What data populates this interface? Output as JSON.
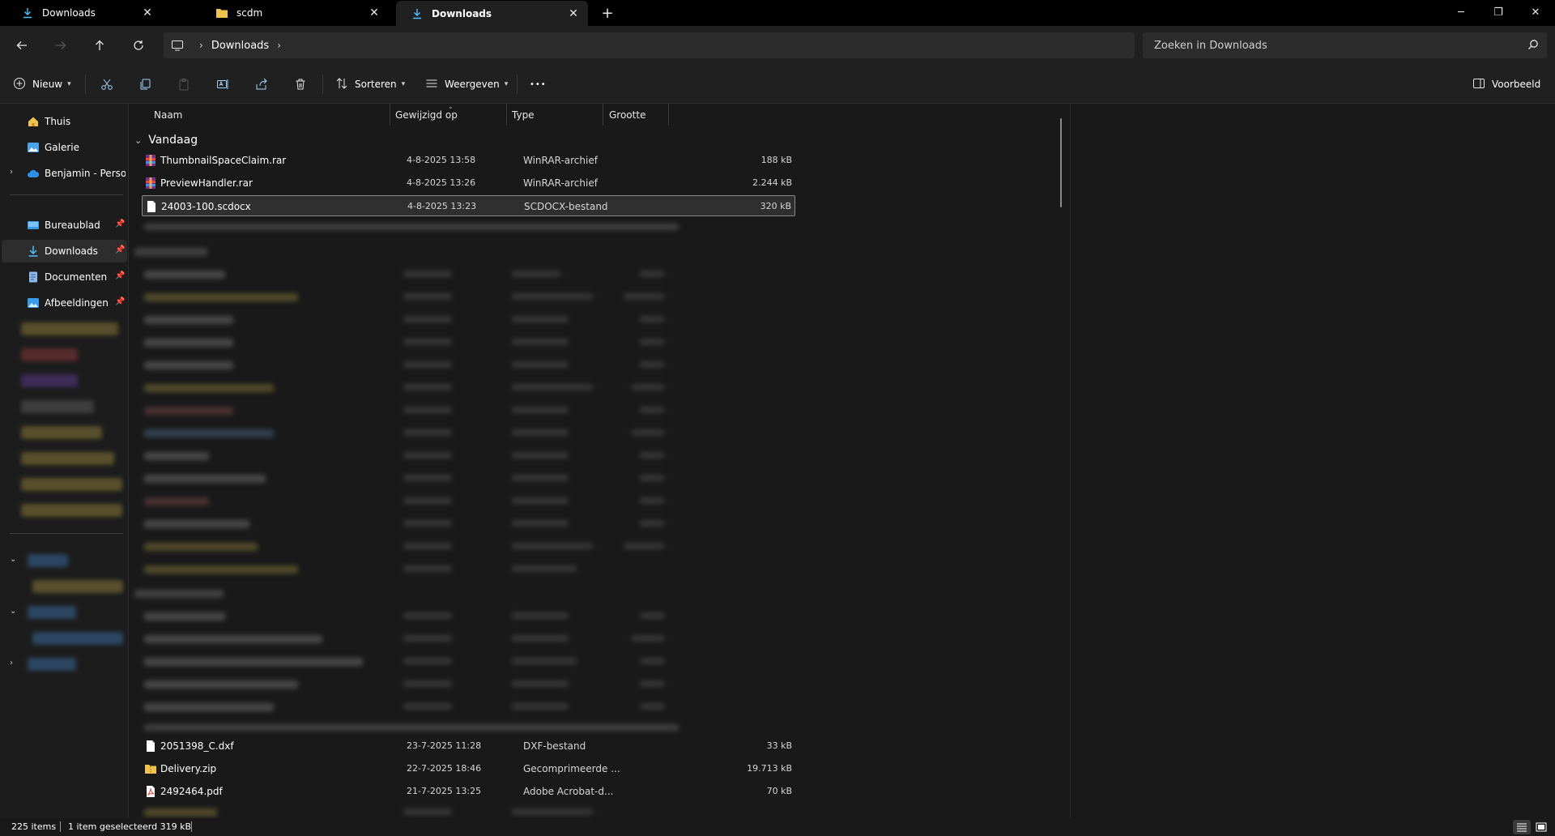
{
  "tabs": [
    {
      "label": "Downloads",
      "icon": "download-icon"
    },
    {
      "label": "scdm",
      "icon": "folder-icon"
    },
    {
      "label": "Downloads",
      "icon": "download-icon",
      "active": true
    }
  ],
  "address": {
    "crumbs": [
      "Downloads"
    ],
    "search_placeholder": "Zoeken in Downloads"
  },
  "commands": {
    "new_label": "Nieuw",
    "sort_label": "Sorteren",
    "view_label": "Weergeven",
    "more_label": "•••",
    "preview_label": "Voorbeeld"
  },
  "sidebar": {
    "top_items": [
      {
        "label": "Thuis",
        "icon": "home-icon"
      },
      {
        "label": "Galerie",
        "icon": "gallery-icon"
      },
      {
        "label": "Benjamin - Persoonlijk",
        "icon": "onedrive-icon"
      }
    ],
    "pinned": [
      {
        "label": "Bureaublad",
        "icon": "desktop-icon"
      },
      {
        "label": "Downloads",
        "icon": "download-icon",
        "selected": true
      },
      {
        "label": "Documenten",
        "icon": "documents-icon"
      },
      {
        "label": "Afbeeldingen",
        "icon": "pictures-icon"
      }
    ]
  },
  "columns": {
    "name": "Naam",
    "modified": "Gewijzigd op",
    "type": "Type",
    "size": "Grootte"
  },
  "groups": {
    "today": "Vandaag"
  },
  "files_top": [
    {
      "name": "ThumbnailSpaceClaim.rar",
      "date": "4-8-2025 13:58",
      "type": "WinRAR-archief",
      "size": "188 kB",
      "icon": "rar-archive-icon"
    },
    {
      "name": "PreviewHandler.rar",
      "date": "4-8-2025 13:26",
      "type": "WinRAR-archief",
      "size": "2.244 kB",
      "icon": "rar-archive-icon"
    },
    {
      "name": "24003-100.scdocx",
      "date": "4-8-2025 13:23",
      "type": "SCDOCX-bestand",
      "size": "320 kB",
      "icon": "file-icon",
      "selected": true
    }
  ],
  "files_bottom": [
    {
      "name": "2051398_C.dxf",
      "date": "23-7-2025 11:28",
      "type": "DXF-bestand",
      "size": "33 kB",
      "icon": "file-icon"
    },
    {
      "name": "Delivery.zip",
      "date": "22-7-2025 18:46",
      "type": "Gecomprimeerde ...",
      "size": "19.713 kB",
      "icon": "zip-folder-icon"
    },
    {
      "name": "2492464.pdf",
      "date": "21-7-2025 13:25",
      "type": "Adobe Acrobat-d...",
      "size": "70 kB",
      "icon": "pdf-icon"
    }
  ],
  "status": {
    "count": "225 items",
    "selection": "1 item geselecteerd  319 kB"
  },
  "colors": {
    "accent": "#4cc2ff",
    "folder": "#f0c34d",
    "pdf": "#e0453a"
  }
}
